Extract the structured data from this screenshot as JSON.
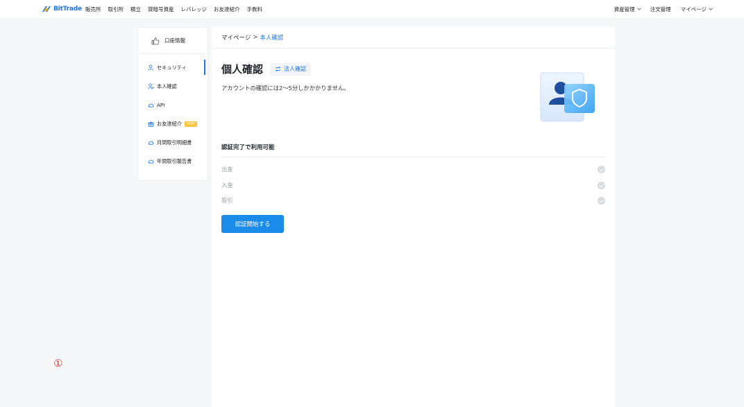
{
  "nav": {
    "logo_text": "BitTrade",
    "items": [
      "販売所",
      "取引所",
      "積立",
      "貸暗号資産",
      "レバレッジ",
      "お友達紹介",
      "手数料"
    ],
    "right_items": [
      "資産管理",
      "注文管理",
      "マイページ"
    ]
  },
  "sidebar": {
    "header": "口座情報",
    "items": [
      {
        "label": "セキュリティ",
        "icon": "user-icon"
      },
      {
        "label": "本人確認",
        "icon": "user-check-icon"
      },
      {
        "label": "API",
        "icon": "cloud-icon"
      },
      {
        "label": "お友達紹介",
        "icon": "gift-icon",
        "badge": "NEW"
      },
      {
        "label": "月間取引明細書",
        "icon": "cloud-icon"
      },
      {
        "label": "年間取引報告書",
        "icon": "cloud-icon"
      }
    ]
  },
  "breadcrumb": {
    "parent": "マイページ",
    "separator": ">",
    "current": "本人確認"
  },
  "main": {
    "title": "個人確認",
    "switch_label": "法人確認",
    "subtitle": "アカウントの確認には2〜5分しかかかりません。",
    "section_title": "認証完了で利用可能",
    "features": [
      "出金",
      "入金",
      "取引"
    ],
    "start_button": "認証開始する"
  },
  "annotation": "①",
  "colors": {
    "accent": "#1a73e8",
    "button": "#1a8be8",
    "badge": "#ffc43d",
    "annotation": "#e0392b"
  }
}
